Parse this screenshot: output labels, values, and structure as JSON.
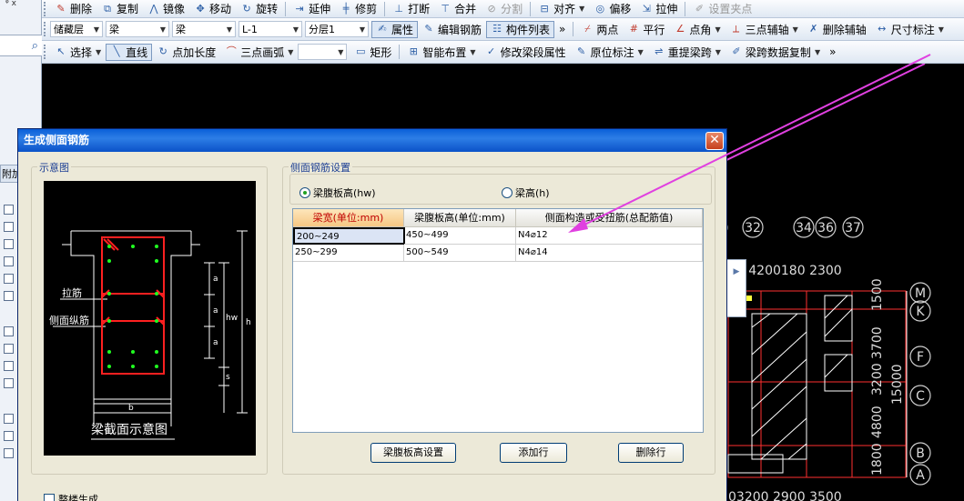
{
  "toolbar1": {
    "items": [
      {
        "label": "删除",
        "icon": "delete-icon"
      },
      {
        "label": "复制",
        "icon": "copy-icon"
      },
      {
        "label": "镜像",
        "icon": "mirror-icon"
      },
      {
        "label": "移动",
        "icon": "move-icon"
      },
      {
        "label": "旋转",
        "icon": "rotate-icon"
      },
      {
        "label": "延伸",
        "icon": "extend-icon"
      },
      {
        "label": "修剪",
        "icon": "trim-icon"
      },
      {
        "label": "打断",
        "icon": "break-icon"
      },
      {
        "label": "合并",
        "icon": "merge-icon"
      },
      {
        "label": "分割",
        "icon": "split-icon"
      },
      {
        "label": "对齐",
        "icon": "align-icon"
      },
      {
        "label": "偏移",
        "icon": "offset-icon"
      },
      {
        "label": "拉伸",
        "icon": "stretch-icon"
      },
      {
        "label": "设置夹点",
        "icon": "grip-point-icon"
      }
    ],
    "pin": "ᵠ x"
  },
  "toolbar2": {
    "floor": "储藏层",
    "category": "梁",
    "type": "梁",
    "element": "L-1",
    "layer": "分层1",
    "attr_btn": "属性",
    "edit_rebar_btn": "编辑钢筋",
    "component_list_btn": "构件列表",
    "more": "»",
    "two_points": "两点",
    "parallel": "平行",
    "point_angle": "点角",
    "three_point_axis": "三点辅轴",
    "delete_axis": "删除辅轴",
    "dim_label": "尺寸标注"
  },
  "toolbar3": {
    "select": "选择",
    "line": "直线",
    "point_length": "点加长度",
    "three_point_arc": "三点画弧",
    "rect": "矩形",
    "smart_layout": "智能布置",
    "modify_span": "修改梁段属性",
    "in_situ_label": "原位标注",
    "re_extract_span": "重提梁跨",
    "copy_span_data": "梁跨数据复制",
    "more": "»"
  },
  "left_panel": {
    "tab_label": "附加"
  },
  "canvas": {
    "axis_numbers": [
      "32",
      "34",
      "36",
      "37"
    ],
    "axis_letters": [
      "M",
      "K",
      "F",
      "C",
      "B",
      "A"
    ],
    "top_dims": "00 4200180 2300",
    "bottom_dims": "03200 2900 3500",
    "right_dims": [
      "1500",
      "3700",
      "3200",
      "15000",
      "4800",
      "1800"
    ],
    "lead_paren": ")"
  },
  "dialog": {
    "title": "生成侧面钢筋",
    "close": "✕",
    "schematic_group": "示意图",
    "settings_group": "侧面钢筋设置",
    "radio_hw": "梁腹板高(hw)",
    "radio_h": "梁高(h)",
    "radio_selected": "hw",
    "columns": [
      "梁宽(单位:mm)",
      "梁腹板高(单位:mm)",
      "侧面构造或受扭筋(总配筋值)"
    ],
    "rows": [
      [
        "200~249",
        "450~499",
        "N4⌀12"
      ],
      [
        "250~299",
        "500~549",
        "N4⌀14"
      ]
    ],
    "btn_web_height": "梁腹板高设置",
    "btn_add_row": "添加行",
    "btn_delete_row": "删除行",
    "checkbox_label": "整楼生成",
    "schematic": {
      "tie_label": "拉筋",
      "side_long_label": "侧面纵筋",
      "caption": "梁截面示意图",
      "a": "a",
      "hw": "hw",
      "h": "h",
      "s": "s",
      "b": "b"
    }
  },
  "colors": {
    "title_bar": "#0a5fd8",
    "grid_header_sel": "#f6c783",
    "magenta_arrow": "#e040e0",
    "rebar_red": "#ff2020",
    "rebar_green": "#20ff20"
  }
}
